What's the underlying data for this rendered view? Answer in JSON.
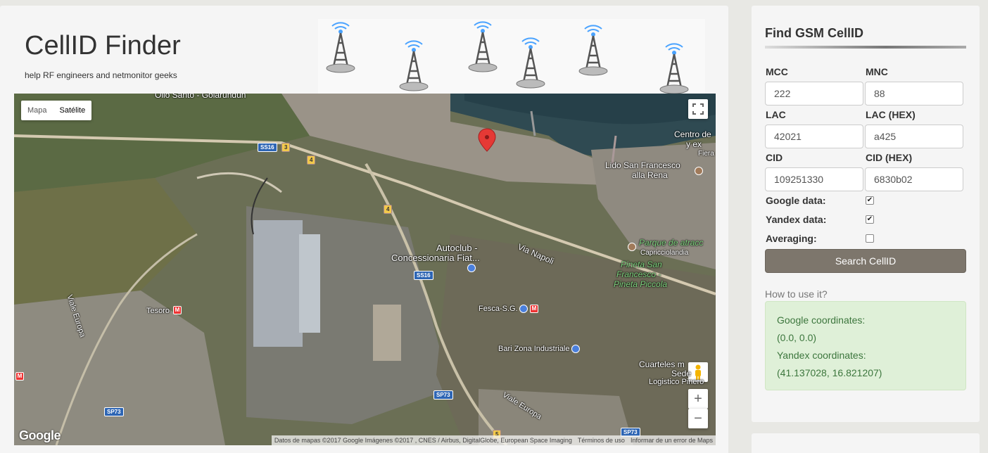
{
  "header": {
    "title": "CellID Finder",
    "subtitle": "help RF engineers and netmonitor geeks"
  },
  "map": {
    "type_map": "Mapa",
    "type_satellite": "Satélite",
    "zoom_in": "+",
    "zoom_out": "−",
    "google_logo": "Google",
    "attribution": "Datos de mapas ©2017 Google Imágenes ©2017 , CNES / Airbus, DigitalGlobe, European Space Imaging",
    "terms": "Términos de uso",
    "report": "Informar de un error de Maps",
    "labels": {
      "olio": "Olio Santo - Golarundun",
      "centro": "Centro de",
      "centro2": "y ex",
      "fiera": "Fiera",
      "lido": "Lido San Francesco",
      "lido2": "alla Rena",
      "parque": "Parque de atracc",
      "capricc": "Capricciolandia",
      "pineta1": "Pineta San",
      "pineta2": "Francesco -",
      "pineta3": "Pineta Piccola",
      "autoclub1": "Autoclub -",
      "autoclub2": "Concessionaria Fiat...",
      "vianapoli": "Via Napoli",
      "tesoro": "Tesoro",
      "fesca": "Fesca-S.G.",
      "bari": "Bari Zona Industriale",
      "viaeuropa1": "Viale Europa",
      "viaeuropa2": "Viale Europa",
      "cuarteles1": "Cuarteles m",
      "cuarteles2": "Sede",
      "cuarteles3": "Logistico Pinero",
      "ss16a": "SS16",
      "ss16b": "SS16",
      "sp73a": "SP73",
      "sp73b": "SP73",
      "sp73c": "SP73",
      "r3": "3",
      "r4a": "4",
      "r4b": "4",
      "r5": "5",
      "metro": "M"
    }
  },
  "form": {
    "title": "Find GSM CellID",
    "mcc_label": "MCC",
    "mcc_value": "222",
    "mnc_label": "MNC",
    "mnc_value": "88",
    "lac_label": "LAC",
    "lac_value": "42021",
    "lachex_label": "LAC (HEX)",
    "lachex_value": "a425",
    "cid_label": "CID",
    "cid_value": "109251330",
    "cidhex_label": "CID (HEX)",
    "cidhex_value": "6830b02",
    "google_label": "Google data:",
    "google_checked": true,
    "yandex_label": "Yandex data:",
    "yandex_checked": true,
    "averaging_label": "Averaging:",
    "averaging_checked": false,
    "search_button": "Search CellID",
    "howto": "How to use it?"
  },
  "results": {
    "google_label": "Google coordinates:",
    "google_value": "(0.0, 0.0)",
    "yandex_label": "Yandex coordinates:",
    "yandex_value": "(41.137028, 16.821207)"
  },
  "colors": {
    "button": "#7d766c",
    "result_bg": "#dff0d8",
    "result_text": "#3c763d",
    "marker": "#e53935"
  }
}
